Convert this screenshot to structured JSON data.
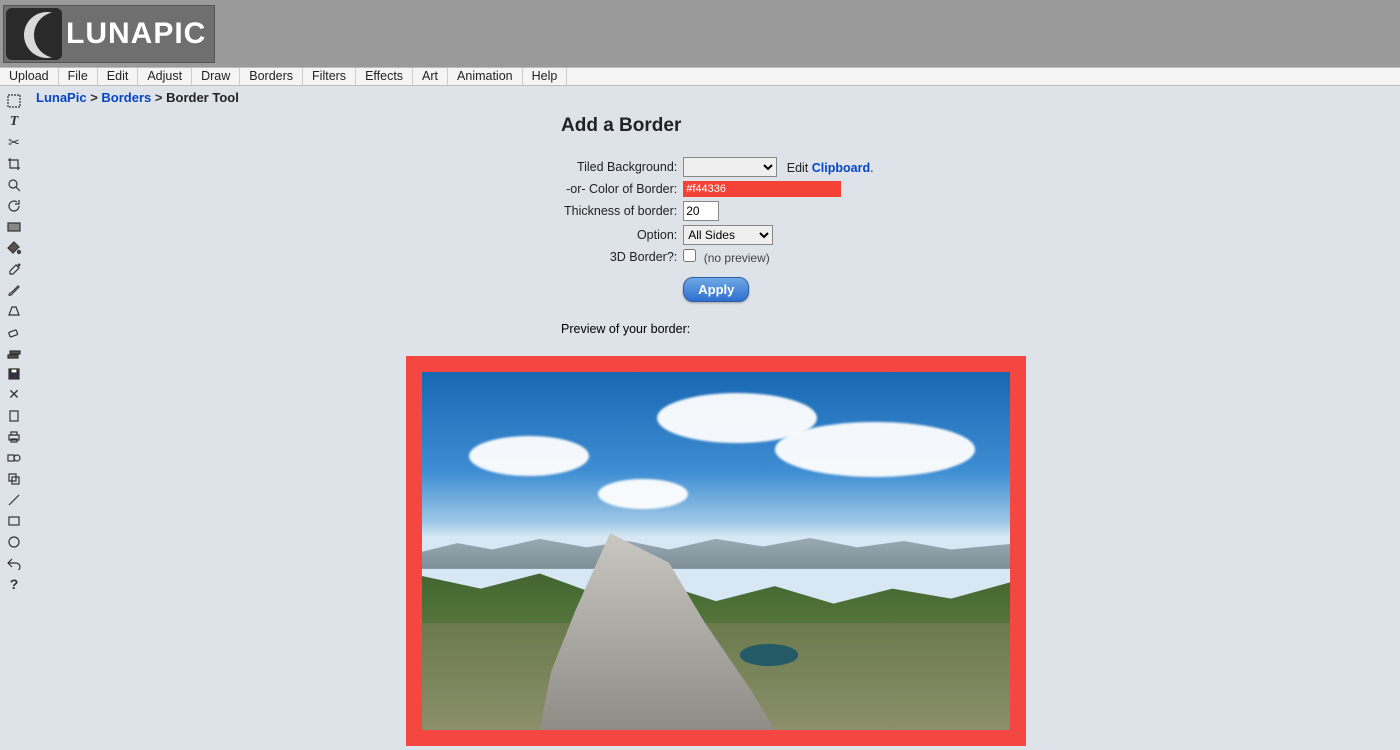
{
  "logo_text": "LUNAPIC",
  "menu": [
    "Upload",
    "File",
    "Edit",
    "Adjust",
    "Draw",
    "Borders",
    "Filters",
    "Effects",
    "Art",
    "Animation",
    "Help"
  ],
  "breadcrumb": {
    "home": "LunaPic",
    "mid": "Borders",
    "current": "Border Tool",
    "sep": ">"
  },
  "title": "Add a Border",
  "form": {
    "tiled_label": "Tiled Background:",
    "edit_text": "Edit ",
    "clipboard": "Clipboard",
    "color_label": "-or- Color of Border:",
    "color_value": "#f44336",
    "thickness_label": "Thickness of border:",
    "thickness_value": "20",
    "option_label": "Option:",
    "option_value": "All Sides",
    "threed_label": "3D Border?:",
    "nopreview": "(no preview)",
    "apply": "Apply"
  },
  "preview_label": "Preview of your border:",
  "toolbar_icons": [
    "select-icon",
    "text-icon",
    "cut-icon",
    "crop-icon",
    "zoom-icon",
    "rotate-icon",
    "gradient-icon",
    "fill-icon",
    "eyedropper-icon",
    "brush-icon",
    "perspective-icon",
    "eraser-icon",
    "layers-icon",
    "save-icon",
    "close-icon",
    "blank-icon",
    "print-icon",
    "shapes-icon",
    "duplicate-icon",
    "line-icon",
    "rect-icon",
    "circle-icon",
    "undo-icon",
    "help-icon"
  ]
}
